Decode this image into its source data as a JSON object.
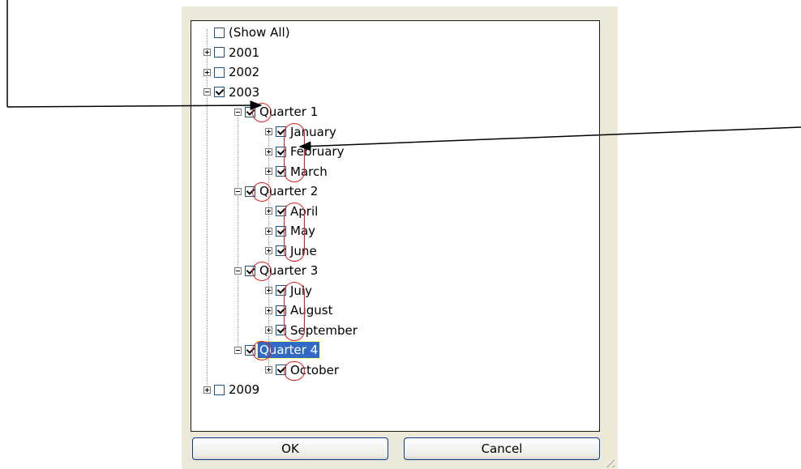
{
  "tree": {
    "items": [
      {
        "label": "(Show All)",
        "level": 0,
        "expander": "none",
        "checked": false
      },
      {
        "label": "2001",
        "level": 0,
        "expander": "plus",
        "checked": false
      },
      {
        "label": "2002",
        "level": 0,
        "expander": "plus",
        "checked": false
      },
      {
        "label": "2003",
        "level": 0,
        "expander": "minus",
        "checked": true
      },
      {
        "label": "Quarter 1",
        "level": 1,
        "expander": "minus",
        "checked": true
      },
      {
        "label": "January",
        "level": 2,
        "expander": "plus",
        "checked": true
      },
      {
        "label": "February",
        "level": 2,
        "expander": "plus",
        "checked": true
      },
      {
        "label": "March",
        "level": 2,
        "expander": "plus",
        "checked": true
      },
      {
        "label": "Quarter 2",
        "level": 1,
        "expander": "minus",
        "checked": true
      },
      {
        "label": "April",
        "level": 2,
        "expander": "plus",
        "checked": true
      },
      {
        "label": "May",
        "level": 2,
        "expander": "plus",
        "checked": true
      },
      {
        "label": "June",
        "level": 2,
        "expander": "plus",
        "checked": true
      },
      {
        "label": "Quarter 3",
        "level": 1,
        "expander": "minus",
        "checked": true
      },
      {
        "label": "July",
        "level": 2,
        "expander": "plus",
        "checked": true
      },
      {
        "label": "August",
        "level": 2,
        "expander": "plus",
        "checked": true
      },
      {
        "label": "September",
        "level": 2,
        "expander": "plus",
        "checked": true
      },
      {
        "label": "Quarter 4",
        "level": 1,
        "expander": "minus",
        "checked": true,
        "selected": true
      },
      {
        "label": "October",
        "level": 2,
        "expander": "plus",
        "checked": true
      },
      {
        "label": "2009",
        "level": 0,
        "expander": "plus",
        "checked": false
      }
    ]
  },
  "buttons": {
    "ok_label": "OK",
    "cancel_label": "Cancel"
  },
  "colors": {
    "annotation": "#e01e1e",
    "selection": "#316ac5",
    "dialog_background": "#ece9d8"
  },
  "icons": {
    "expander_plus": "plus-box-icon",
    "expander_minus": "minus-box-icon",
    "checkbox": "checkmark-icon",
    "grip": "resize-grip-icon"
  }
}
